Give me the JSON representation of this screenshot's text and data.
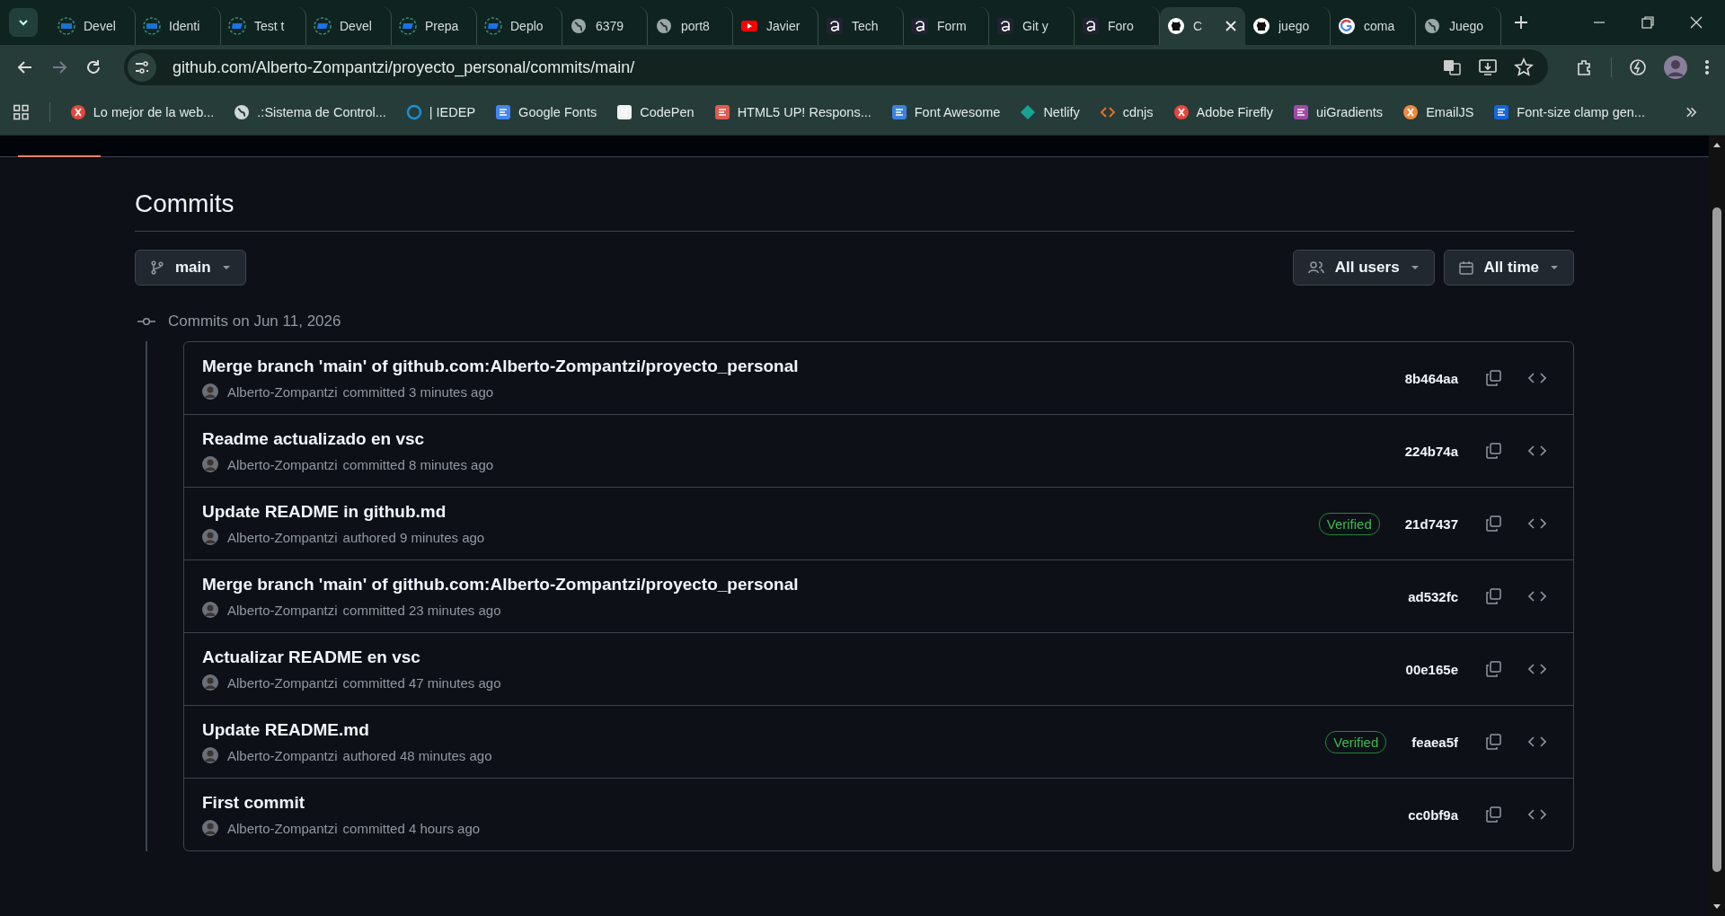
{
  "browser": {
    "tabs": [
      {
        "title": "Devel",
        "kind": "sap",
        "selected": false
      },
      {
        "title": "Identi",
        "kind": "sap",
        "selected": false
      },
      {
        "title": "Test t",
        "kind": "flag",
        "selected": false
      },
      {
        "title": "Devel",
        "kind": "flag",
        "selected": false
      },
      {
        "title": "Prepa",
        "kind": "flag",
        "selected": false
      },
      {
        "title": "Deplo",
        "kind": "flag",
        "selected": false
      },
      {
        "title": "6379",
        "kind": "globe",
        "selected": false
      },
      {
        "title": "port8",
        "kind": "globe",
        "selected": false
      },
      {
        "title": "Javier",
        "kind": "youtube",
        "selected": false
      },
      {
        "title": "Tech",
        "kind": "a",
        "selected": false
      },
      {
        "title": "Form",
        "kind": "a",
        "selected": false
      },
      {
        "title": "Git y",
        "kind": "a",
        "selected": false
      },
      {
        "title": "Foro",
        "kind": "a",
        "selected": false
      },
      {
        "title": "C",
        "kind": "github",
        "selected": true
      },
      {
        "title": "juego",
        "kind": "github",
        "selected": false
      },
      {
        "title": "coma",
        "kind": "google",
        "selected": false
      },
      {
        "title": "Juego",
        "kind": "globe",
        "selected": false
      }
    ],
    "address": "github.com/Alberto-Zompantzi/proyecto_personal/commits/main/",
    "bookmarks": [
      {
        "title": "Lo mejor de la web...",
        "kind": "red"
      },
      {
        "title": ".:Sistema de Control...",
        "kind": "globe"
      },
      {
        "title": "| IEDEP",
        "kind": "ring"
      },
      {
        "title": "Google Fonts",
        "kind": "multi"
      },
      {
        "title": "CodePen",
        "kind": "white"
      },
      {
        "title": "HTML5 UP! Respons...",
        "kind": "coral"
      },
      {
        "title": "Font Awesome",
        "kind": "flagblue"
      },
      {
        "title": "Netlify",
        "kind": "teal"
      },
      {
        "title": "cdnjs",
        "kind": "code"
      },
      {
        "title": "Adobe Firefly",
        "kind": "red"
      },
      {
        "title": "uiGradients",
        "kind": "purple"
      },
      {
        "title": "EmailJS",
        "kind": "orange"
      },
      {
        "title": "Font-size clamp gen...",
        "kind": "blue"
      }
    ]
  },
  "page": {
    "title": "Commits",
    "branch": "main",
    "filters": [
      "All users",
      "All time"
    ],
    "group": {
      "heading": "Commits on Jun 11, 2026",
      "commits": [
        {
          "message": "Merge branch 'main' of github.com:Alberto-Zompantzi/proyecto_personal",
          "author": "Alberto-Zompantzi",
          "detail": "committed 3 minutes ago",
          "sha": "8b464aa"
        },
        {
          "message": "Readme actualizado en vsc",
          "author": "Alberto-Zompantzi",
          "detail": "committed 8 minutes ago",
          "sha": "224b74a"
        },
        {
          "message": "Update README in github.md",
          "author": "Alberto-Zompantzi",
          "detail": "authored 9 minutes ago",
          "badge": "Verified",
          "sha": "21d7437"
        },
        {
          "message": "Merge branch 'main' of github.com:Alberto-Zompantzi/proyecto_personal",
          "author": "Alberto-Zompantzi",
          "detail": "committed 23 minutes ago",
          "sha": "ad532fc"
        },
        {
          "message": "Actualizar README en vsc",
          "author": "Alberto-Zompantzi",
          "detail": "committed 47 minutes ago",
          "sha": "00e165e"
        },
        {
          "message": "Update README.md",
          "author": "Alberto-Zompantzi",
          "detail": "authored 48 minutes ago",
          "badge": "Verified",
          "sha": "feaea5f"
        },
        {
          "message": "First commit",
          "author": "Alberto-Zompantzi",
          "detail": "committed 4 hours ago",
          "sha": "cc0bf9a"
        }
      ]
    }
  }
}
